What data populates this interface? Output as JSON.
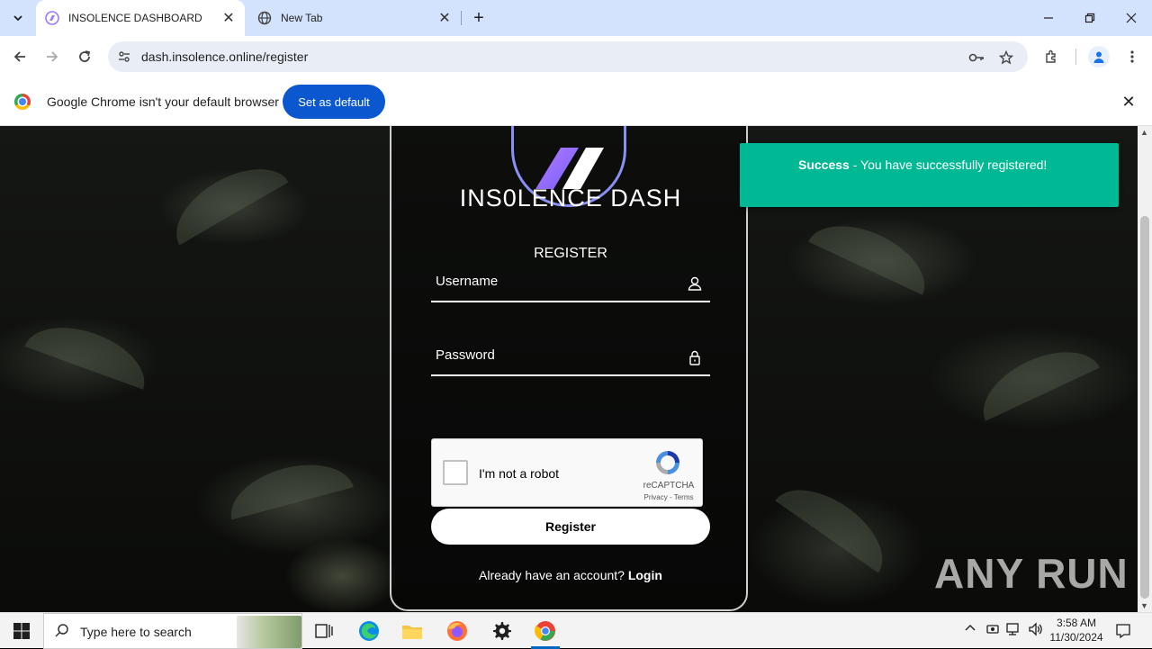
{
  "browser": {
    "tabs": [
      {
        "title": "INSOLENCE DASHBOARD",
        "active": true
      },
      {
        "title": "New Tab",
        "active": false
      }
    ],
    "url": "dash.insolence.online/register"
  },
  "infobar": {
    "message": "Google Chrome isn't your default browser",
    "button": "Set as default"
  },
  "page": {
    "brand": "INS0LENCE DASH",
    "title": "REGISTER",
    "username_placeholder": "Username",
    "password_placeholder": "Password",
    "captcha": {
      "label": "I'm not a robot",
      "brand": "reCAPTCHA",
      "links": "Privacy - Terms"
    },
    "register_button": "Register",
    "login_prompt": "Already have an account?",
    "login_link": "Login"
  },
  "toast": {
    "title": "Success",
    "message": "- You have successfully registered!",
    "color": "#00b894"
  },
  "watermark": "ANY RUN",
  "taskbar": {
    "search_placeholder": "Type here to search",
    "time": "3:58 AM",
    "date": "11/30/2024"
  }
}
